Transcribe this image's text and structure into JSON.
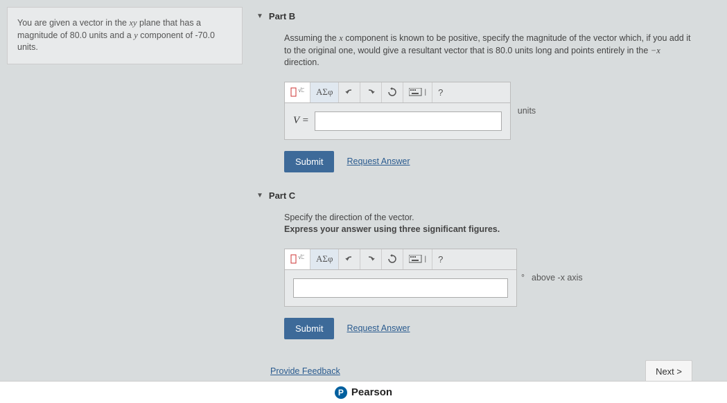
{
  "sidebar": {
    "text_parts": [
      "You are given a vector in the ",
      "xy",
      " plane that has a magnitude of 80.0 units and a ",
      "y",
      " component of -70.0 units."
    ]
  },
  "partB": {
    "header": "Part B",
    "prompt_parts": [
      "Assuming the ",
      "x",
      " component is known to be positive, specify the magnitude of the vector which, if you add it to the original one, would give a resultant vector that is 80.0 units long and points entirely in the ",
      "−x",
      " direction."
    ],
    "var_label": "V =",
    "unit": "units",
    "submit": "Submit",
    "request": "Request Answer"
  },
  "partC": {
    "header": "Part C",
    "prompt1": "Specify the direction of the vector.",
    "prompt2": "Express your answer using three significant figures.",
    "degree": "°",
    "unit": "above -x axis",
    "submit": "Submit",
    "request": "Request Answer"
  },
  "toolbar": {
    "sigma": "ΑΣφ",
    "help": "?"
  },
  "footer": {
    "feedback": "Provide Feedback",
    "next": "Next >"
  },
  "pearson": "Pearson"
}
